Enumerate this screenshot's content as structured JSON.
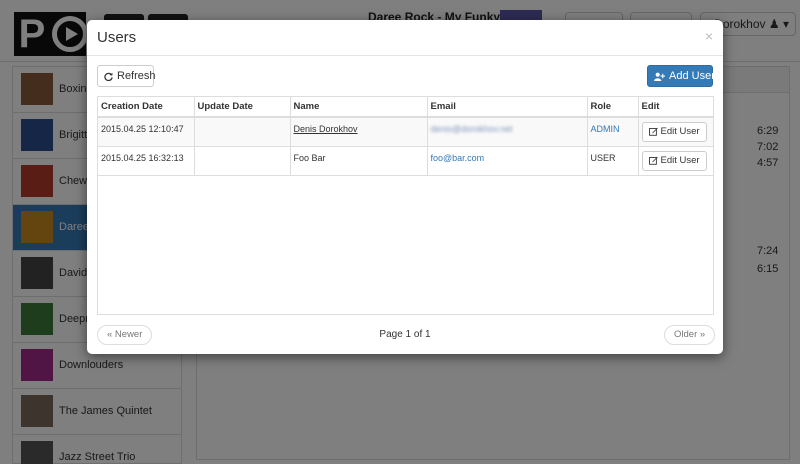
{
  "app": {
    "now_playing": "Daree Rock - My Funky Mo...",
    "user_label": "e Dorokhov",
    "sidebar_albums": [
      {
        "name": "Boxing",
        "art_color": "#8a5a3a"
      },
      {
        "name": "Brigitte",
        "art_color": "#2c4d8c"
      },
      {
        "name": "Chewba",
        "art_color": "#b33a2a"
      },
      {
        "name": "Daree I",
        "art_color": "#c98a1f"
      },
      {
        "name": "David T",
        "art_color": "#444444"
      },
      {
        "name": "Deepne",
        "art_color": "#3a7a3a"
      },
      {
        "name": "Downlouders",
        "art_color": "#a02a8a"
      },
      {
        "name": "The James Quintet",
        "art_color": "#7a6a5a"
      },
      {
        "name": "Jazz Street Trio",
        "art_color": "#555555"
      }
    ],
    "track_times": [
      "6:29",
      "7:02",
      "4:57",
      "7:24",
      "6:15"
    ]
  },
  "modal": {
    "title": "Users",
    "close_label": "×",
    "refresh_label": "Refresh",
    "add_user_label": "Add User",
    "columns": [
      "Creation Date",
      "Update Date",
      "Name",
      "Email",
      "Role",
      "Edit"
    ],
    "rows": [
      {
        "creation_date": "2015.04.25 12:10:47",
        "update_date": "",
        "name": "Denis Dorokhov",
        "email": "denis@dorokhov.net",
        "role": "ADMIN",
        "edit_label": "Edit User"
      },
      {
        "creation_date": "2015.04.25 16:32:13",
        "update_date": "",
        "name": "Foo Bar",
        "email": "foo@bar.com",
        "role": "USER",
        "edit_label": "Edit User"
      }
    ],
    "pager": {
      "newer_label": "« Newer",
      "older_label": "Older »",
      "page_info": "Page 1 of 1"
    }
  },
  "colors": {
    "primary": "#337ab7",
    "backdrop": "rgba(0,0,0,0.5)"
  }
}
